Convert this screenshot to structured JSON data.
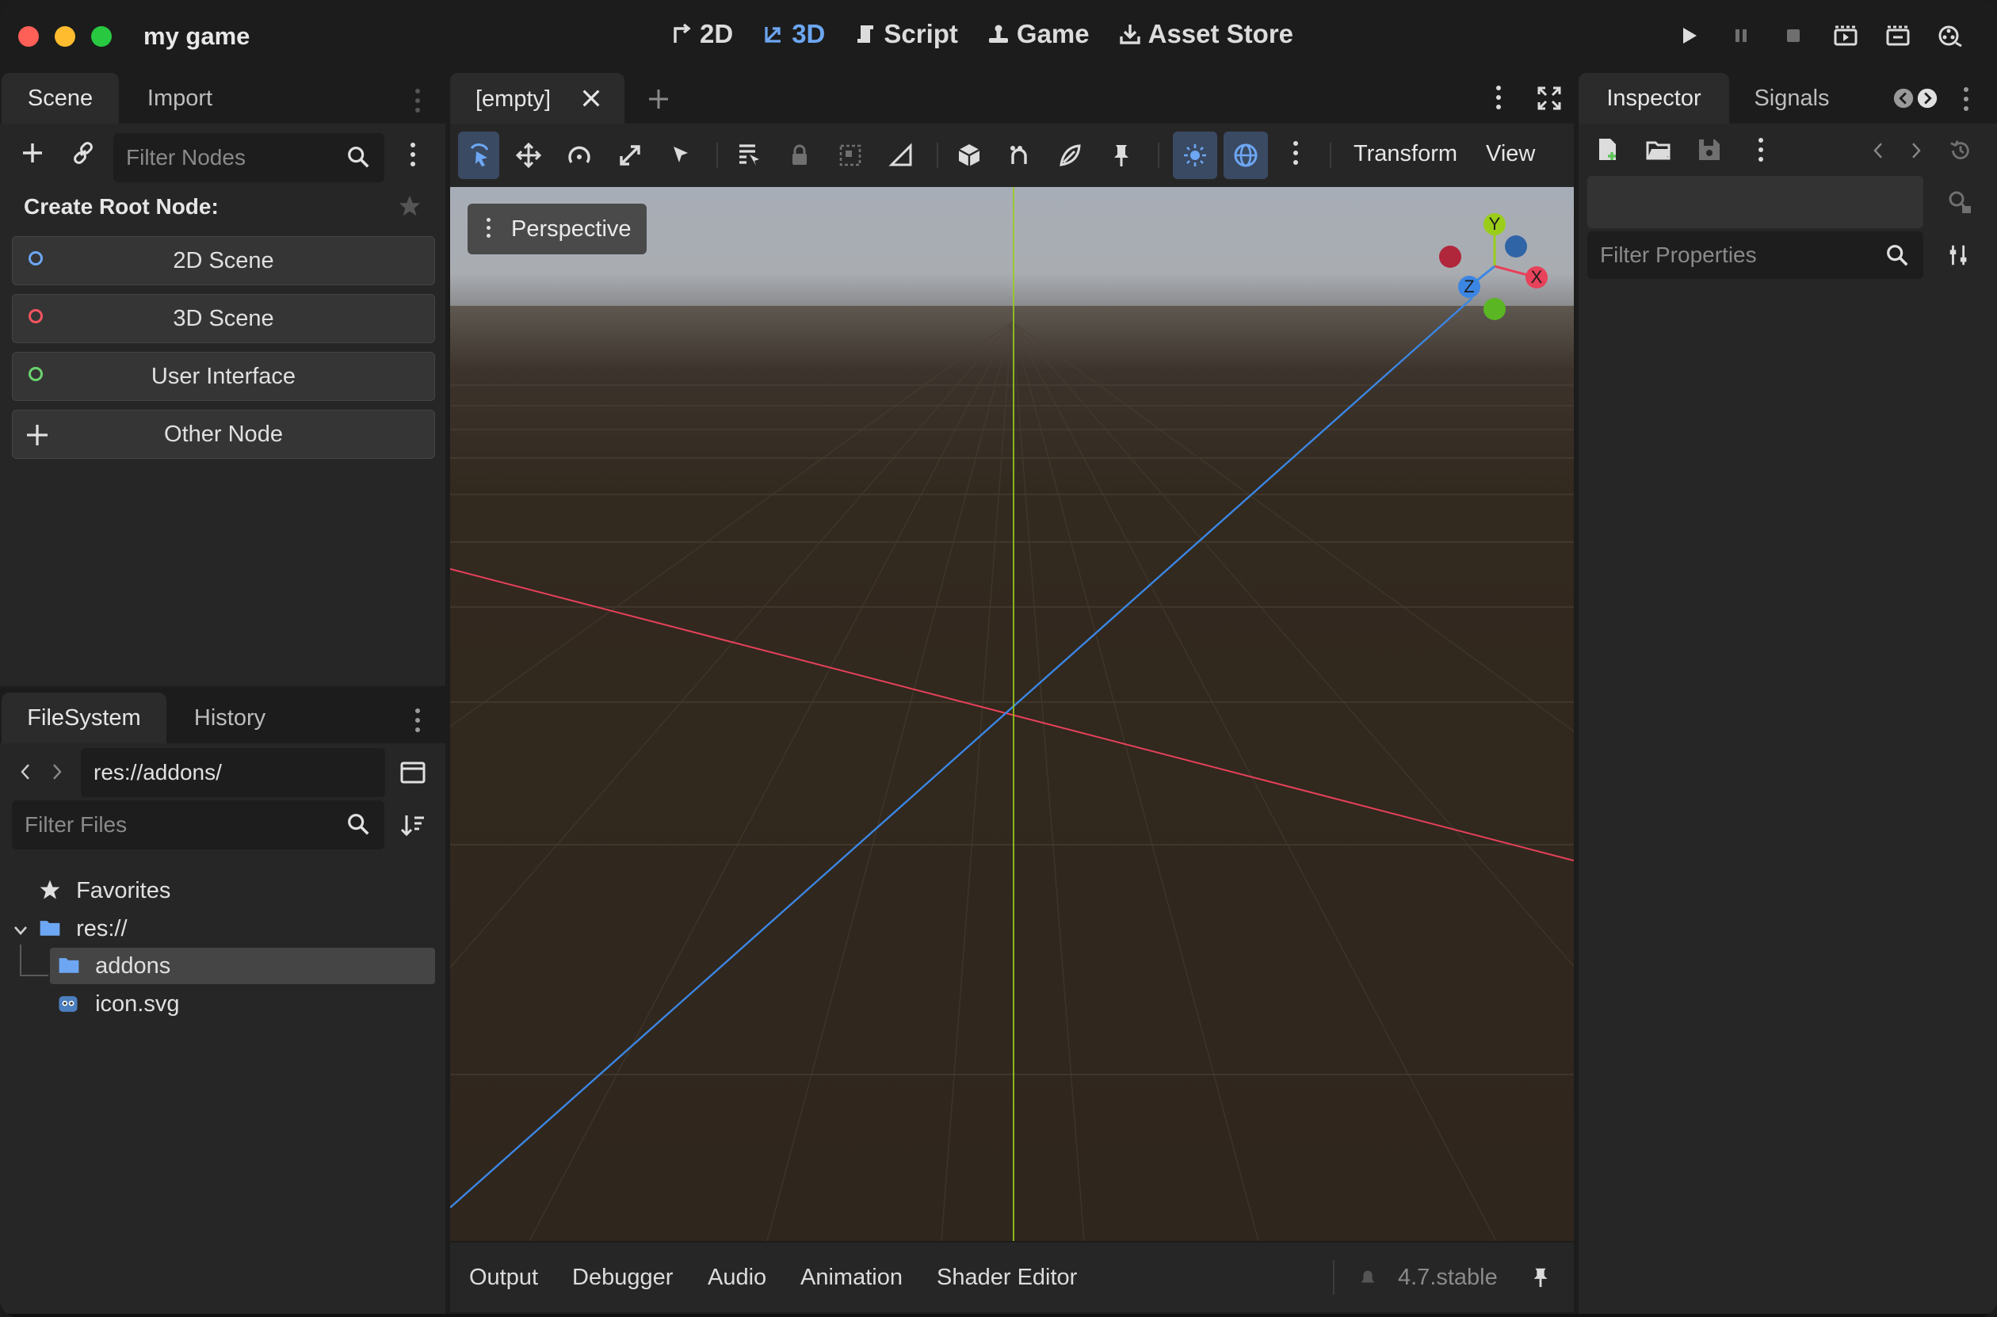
{
  "app": {
    "title": "my game"
  },
  "main_tabs": [
    {
      "label": "2D"
    },
    {
      "label": "3D"
    },
    {
      "label": "Script"
    },
    {
      "label": "Game"
    },
    {
      "label": "Asset Store"
    }
  ],
  "scene_dock": {
    "tabs": [
      {
        "label": "Scene"
      },
      {
        "label": "Import"
      }
    ],
    "filter_placeholder": "Filter Nodes",
    "create_root_label": "Create Root Node:",
    "nodes": [
      {
        "label": "2D Scene",
        "color": "#6da7f3"
      },
      {
        "label": "3D Scene",
        "color": "#f2555f"
      },
      {
        "label": "User Interface",
        "color": "#6cd46f"
      },
      {
        "label": "Other Node"
      }
    ]
  },
  "filesystem_dock": {
    "tabs": [
      {
        "label": "FileSystem"
      },
      {
        "label": "History"
      }
    ],
    "path": "res://addons/",
    "filter_placeholder": "Filter Files",
    "tree": [
      {
        "label": "Favorites",
        "icon": "star-icon"
      },
      {
        "label": "res://",
        "icon": "folder-icon"
      },
      {
        "label": "addons",
        "icon": "folder-icon"
      },
      {
        "label": "icon.svg",
        "icon": "godot-icon"
      }
    ]
  },
  "editor": {
    "scene_tab": "[empty]",
    "menus": {
      "transform": "Transform",
      "view": "View"
    },
    "perspective_label": "Perspective",
    "gizmo": {
      "x": "X",
      "y": "Y",
      "z": "Z"
    }
  },
  "bottom_panel": {
    "tabs": [
      {
        "label": "Output"
      },
      {
        "label": "Debugger"
      },
      {
        "label": "Audio"
      },
      {
        "label": "Animation"
      },
      {
        "label": "Shader Editor"
      }
    ],
    "version": "4.7.stable"
  },
  "inspector_dock": {
    "tabs": [
      {
        "label": "Inspector"
      },
      {
        "label": "Signals"
      }
    ],
    "filter_placeholder": "Filter Properties"
  },
  "colors": {
    "accent": "#6da7f3",
    "x_axis": "#e8415a",
    "y_axis": "#9acd1a",
    "z_axis": "#3b86e3"
  }
}
